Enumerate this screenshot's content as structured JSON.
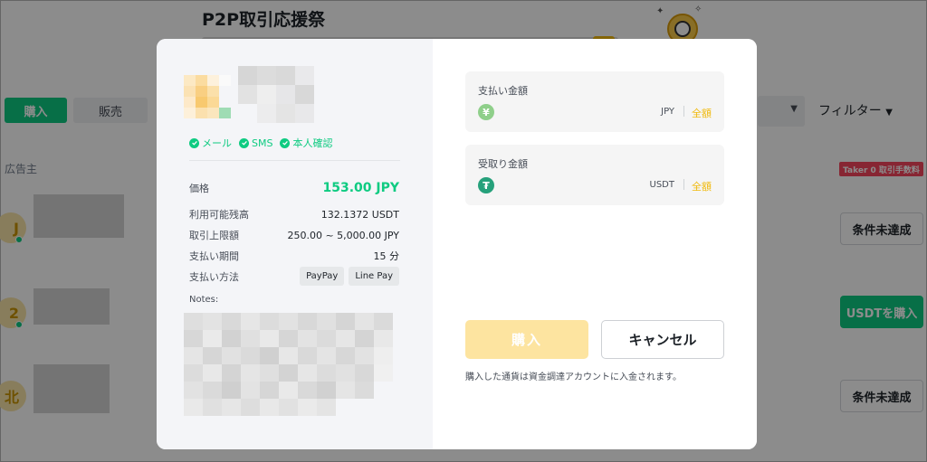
{
  "background": {
    "banner_title": "P2P取引応援祭",
    "tabs": {
      "buy": "購入",
      "sell": "販売"
    },
    "filter_label": "フィルター",
    "advertiser_label": "広告主",
    "taker_badge": "Taker 0 取引手数料",
    "rows": [
      {
        "avatar": "J",
        "action": "条件未達成"
      },
      {
        "avatar": "2",
        "action": "USDTを購入"
      },
      {
        "avatar": "北",
        "action": "条件未達成"
      }
    ]
  },
  "modal": {
    "advertiser": {
      "verifications": [
        "メール",
        "SMS",
        "本人確認"
      ]
    },
    "details": {
      "price": {
        "label": "価格",
        "value": "153.00 JPY"
      },
      "available": {
        "label": "利用可能残高",
        "value": "132.1372 USDT"
      },
      "limit": {
        "label": "取引上限額",
        "value": "250.00 ~ 5,000.00 JPY"
      },
      "period": {
        "label": "支払い期間",
        "value": "15 分"
      },
      "method": {
        "label": "支払い方法",
        "tags": [
          "PayPay",
          "Line Pay"
        ]
      },
      "notes_label": "Notes:"
    },
    "pay_field": {
      "label": "支払い金額",
      "currency": "JPY",
      "all": "全額",
      "icon": "yen-coin-icon"
    },
    "receive_field": {
      "label": "受取り金額",
      "currency": "USDT",
      "all": "全額",
      "icon": "tether-coin-icon"
    },
    "buy_button": "購入",
    "cancel_button": "キャンセル",
    "footnote": "購入した通貨は資金調達アカウントに入金されます。"
  },
  "colors": {
    "green": "#0ecb81",
    "yellow": "#f0b90b",
    "buy_disabled": "#fde4a0"
  }
}
